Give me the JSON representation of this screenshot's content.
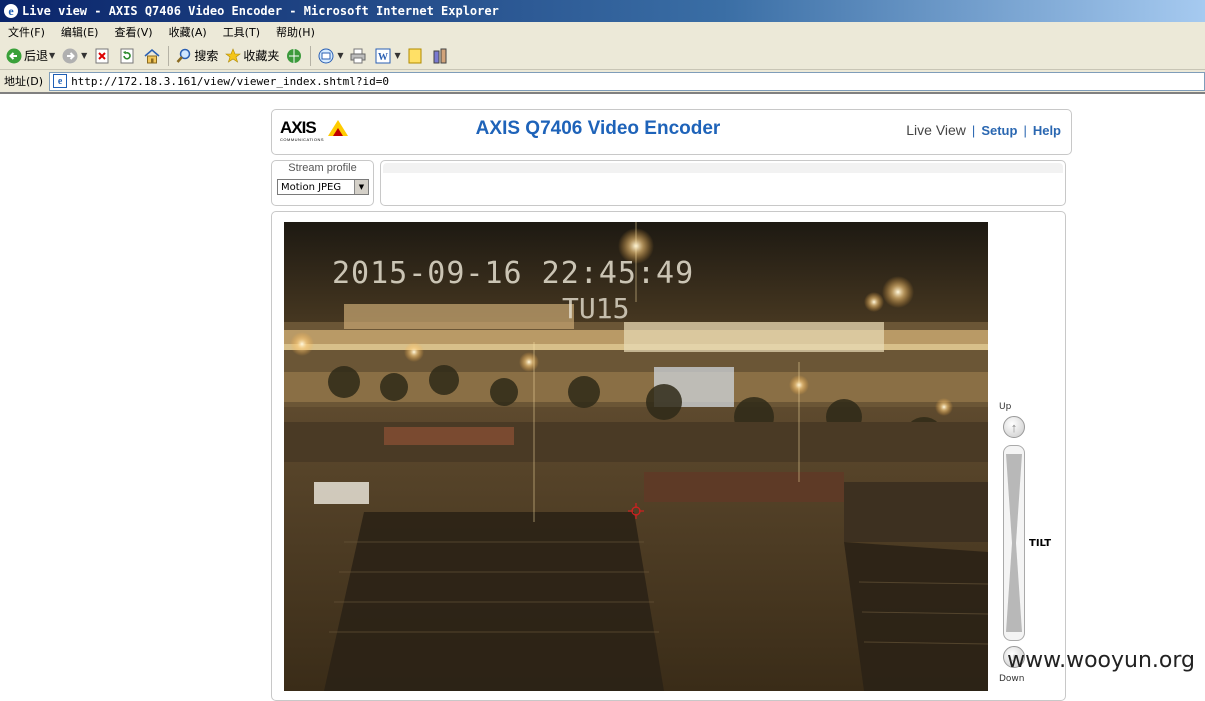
{
  "window": {
    "title": "Live view - AXIS Q7406 Video Encoder - Microsoft Internet Explorer"
  },
  "menu": [
    "文件(F)",
    "编辑(E)",
    "查看(V)",
    "收藏(A)",
    "工具(T)",
    "帮助(H)"
  ],
  "toolbar": {
    "back_label": "后退",
    "search_label": "搜索",
    "favorites_label": "收藏夹"
  },
  "address": {
    "label": "地址(D)",
    "url": "http://172.18.3.161/view/viewer_index.shtml?id=0"
  },
  "header": {
    "logo_text": "AXIS",
    "logo_sub": "COMMUNICATIONS",
    "product_title": "AXIS Q7406 Video Encoder",
    "nav": {
      "live_view": "Live View",
      "setup": "Setup",
      "help": "Help",
      "separator": "|"
    }
  },
  "stream": {
    "label": "Stream profile",
    "selected": "Motion JPEG"
  },
  "video": {
    "timestamp": "2015-09-16 22:45:49",
    "camera_id": "TU15"
  },
  "ptz": {
    "up_label": "Up",
    "down_label": "Down",
    "tilt_label": "TILT"
  },
  "watermark": "www.wooyun.org",
  "colors": {
    "brand_blue": "#1e63b9",
    "logo_yellow": "#ffcc00",
    "logo_red": "#c00000"
  }
}
